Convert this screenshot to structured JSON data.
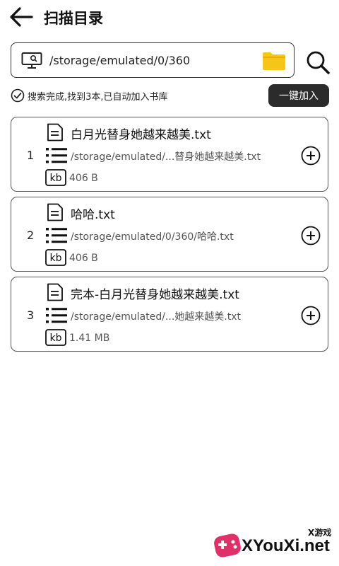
{
  "header": {
    "title": "扫描目录",
    "back_icon": "arrow-left-icon"
  },
  "path_bar": {
    "path": "/storage/emulated/0/360",
    "left_icon": "computer-search-icon",
    "folder_icon": "folder-icon",
    "folder_color": "#F5C518"
  },
  "search": {
    "icon": "search-icon"
  },
  "status": {
    "text": "搜索完成,找到3本,已自动加入书库",
    "icon": "check-circle-icon"
  },
  "add_all": {
    "label": "一键加入"
  },
  "files": [
    {
      "index": "1",
      "name": "白月光替身她越来越美.txt",
      "path": "/storage/emulated/...替身她越来越美.txt",
      "size": "406 B"
    },
    {
      "index": "2",
      "name": "哈哈.txt",
      "path": "/storage/emulated/0/360/哈哈.txt",
      "size": "406 B"
    },
    {
      "index": "3",
      "name": "完本-白月光替身她越来越美.txt",
      "path": "/storage/emulated/...她越来越美.txt",
      "size": "1.41 MB"
    }
  ],
  "watermark": {
    "top": "X游戏",
    "text": "XYouXi.net",
    "accent": "#E0306A"
  }
}
